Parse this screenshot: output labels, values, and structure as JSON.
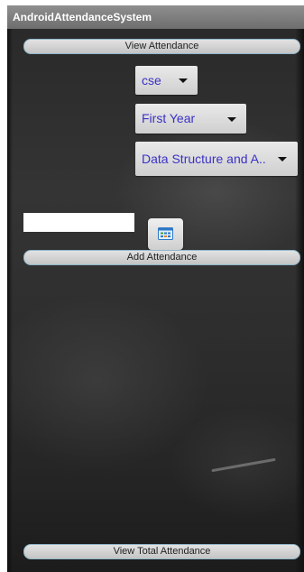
{
  "app": {
    "title": "AndroidAttendanceSystem"
  },
  "buttons": {
    "view_attendance": "View Attendance",
    "add_attendance": "Add Attendance",
    "view_total_attendance": "View Total Attendance"
  },
  "form": {
    "department": {
      "selected": "cse"
    },
    "year": {
      "selected": "First Year"
    },
    "subject": {
      "selected": "Data Structure and A.."
    },
    "date_input": {
      "value": "",
      "placeholder": ""
    },
    "date_picker_icon": "calendar-icon"
  },
  "colors": {
    "spinner_text": "#3b32c6",
    "titlebar": "#7a7a7a",
    "button_border": "#8fb7c9",
    "board": "#2e2e2e"
  }
}
